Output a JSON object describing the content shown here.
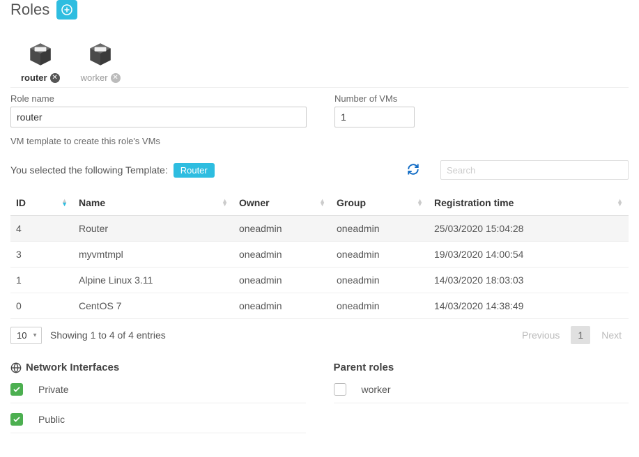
{
  "header": {
    "title": "Roles"
  },
  "tabs": [
    {
      "label": "router",
      "active": true
    },
    {
      "label": "worker",
      "active": false
    }
  ],
  "fields": {
    "role_name_label": "Role name",
    "role_name_value": "router",
    "num_vms_label": "Number of VMs",
    "num_vms_value": "1",
    "template_label": "VM template to create this role's VMs"
  },
  "template_selection": {
    "prefix": "You selected the following Template:",
    "name": "Router"
  },
  "search": {
    "placeholder": "Search"
  },
  "table": {
    "columns": [
      "ID",
      "Name",
      "Owner",
      "Group",
      "Registration time"
    ],
    "rows": [
      {
        "id": "4",
        "name": "Router",
        "owner": "oneadmin",
        "group": "oneadmin",
        "reg": "25/03/2020 15:04:28",
        "selected": true
      },
      {
        "id": "3",
        "name": "myvmtmpl",
        "owner": "oneadmin",
        "group": "oneadmin",
        "reg": "19/03/2020 14:00:54",
        "selected": false
      },
      {
        "id": "1",
        "name": "Alpine Linux 3.11",
        "owner": "oneadmin",
        "group": "oneadmin",
        "reg": "14/03/2020 18:03:03",
        "selected": false
      },
      {
        "id": "0",
        "name": "CentOS 7",
        "owner": "oneadmin",
        "group": "oneadmin",
        "reg": "14/03/2020 14:38:49",
        "selected": false
      }
    ]
  },
  "footer": {
    "page_size": "10",
    "info": "Showing 1 to 4 of 4 entries",
    "prev": "Previous",
    "page": "1",
    "next": "Next"
  },
  "network": {
    "title": "Network Interfaces",
    "items": [
      {
        "label": "Private",
        "checked": true
      },
      {
        "label": "Public",
        "checked": true
      }
    ]
  },
  "parent": {
    "title": "Parent roles",
    "items": [
      {
        "label": "worker",
        "checked": false
      }
    ]
  }
}
